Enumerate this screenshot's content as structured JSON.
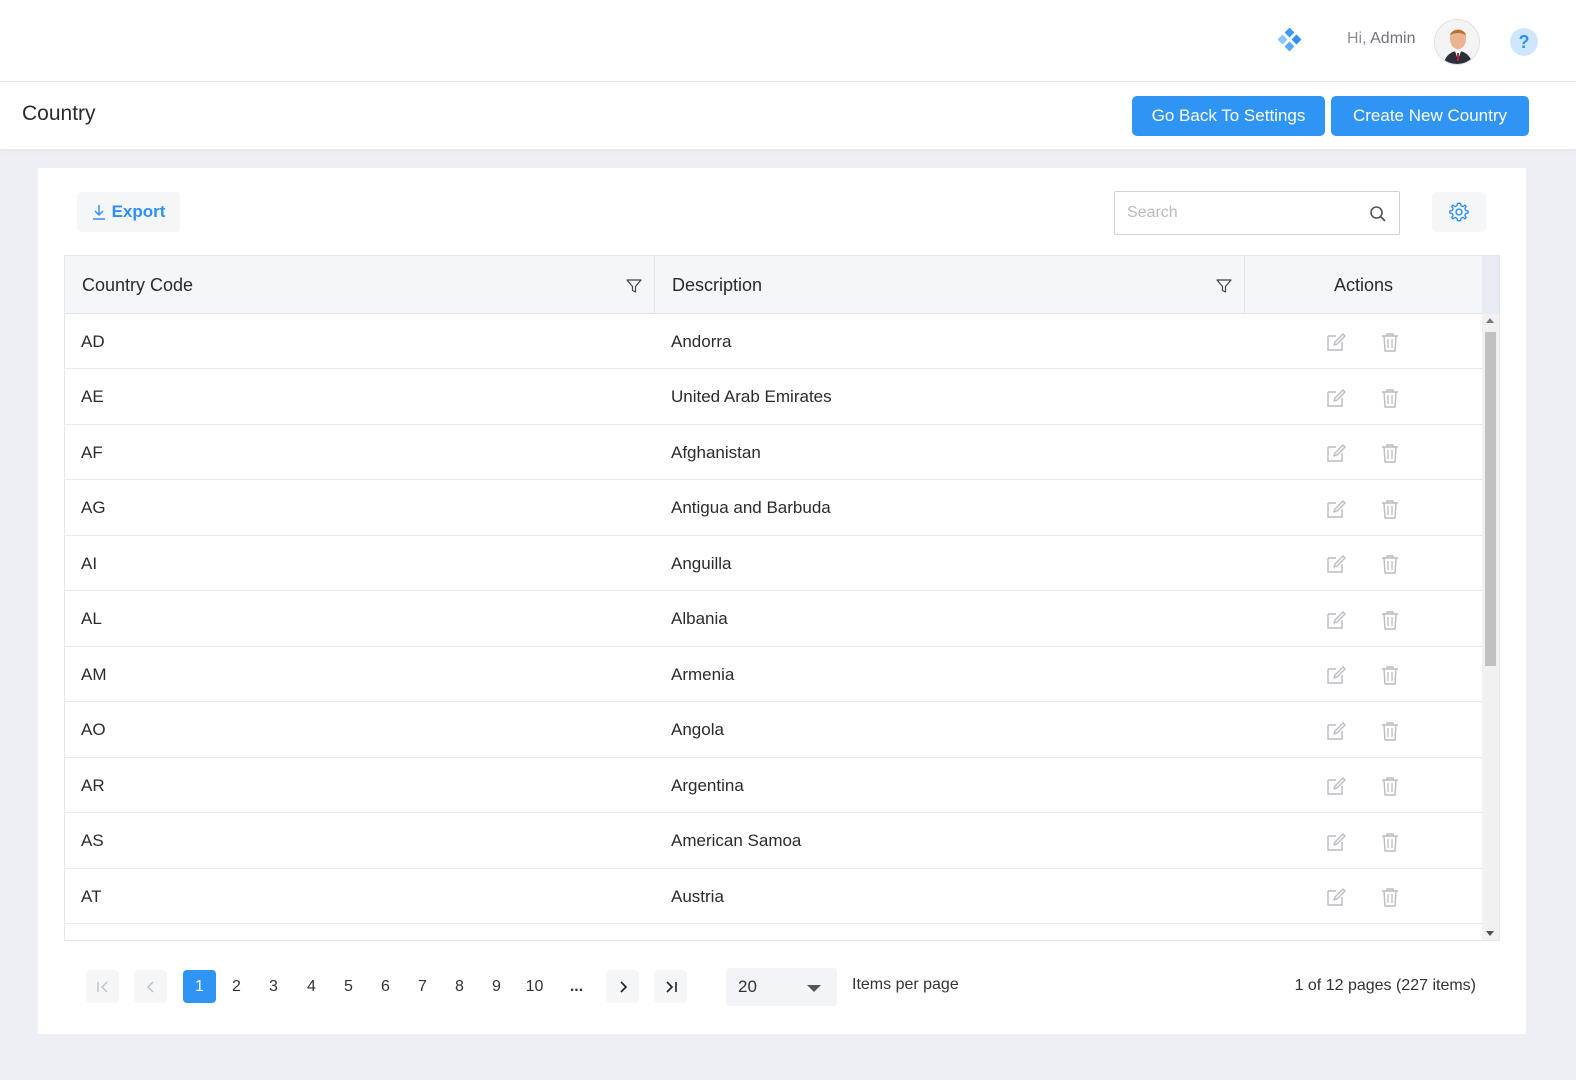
{
  "header": {
    "greeting_prefix": "Hi,",
    "user_name": "Admin",
    "help_symbol": "?"
  },
  "page": {
    "title": "Country",
    "back_button": "Go Back To Settings",
    "create_button": "Create New Country"
  },
  "toolbar": {
    "export_label": "Export",
    "search_placeholder": "Search"
  },
  "table": {
    "columns": [
      "Country Code",
      "Description",
      "Actions"
    ],
    "rows": [
      {
        "code": "AD",
        "description": "Andorra"
      },
      {
        "code": "AE",
        "description": "United Arab Emirates"
      },
      {
        "code": "AF",
        "description": "Afghanistan"
      },
      {
        "code": "AG",
        "description": "Antigua and Barbuda"
      },
      {
        "code": "AI",
        "description": "Anguilla"
      },
      {
        "code": "AL",
        "description": "Albania"
      },
      {
        "code": "AM",
        "description": "Armenia"
      },
      {
        "code": "AO",
        "description": "Angola"
      },
      {
        "code": "AR",
        "description": "Argentina"
      },
      {
        "code": "AS",
        "description": "American Samoa"
      },
      {
        "code": "AT",
        "description": "Austria"
      }
    ]
  },
  "pager": {
    "pages": [
      "1",
      "2",
      "3",
      "4",
      "5",
      "6",
      "7",
      "8",
      "9",
      "10"
    ],
    "current_page": "1",
    "ellipsis": "...",
    "page_size": "20",
    "items_per_page_label": "Items per page",
    "info": "1 of 12 pages (227 items)"
  },
  "colors": {
    "primary": "#2f95f5",
    "header_bg": "#f4f6f9",
    "page_bg": "#edeff5"
  },
  "icons": {
    "logo": "diamond-dots-icon",
    "export": "download-arrow-icon",
    "search": "magnifier-icon",
    "settings": "gear-icon",
    "filter": "funnel-icon",
    "edit": "edit-pencil-icon",
    "delete": "trash-icon"
  }
}
